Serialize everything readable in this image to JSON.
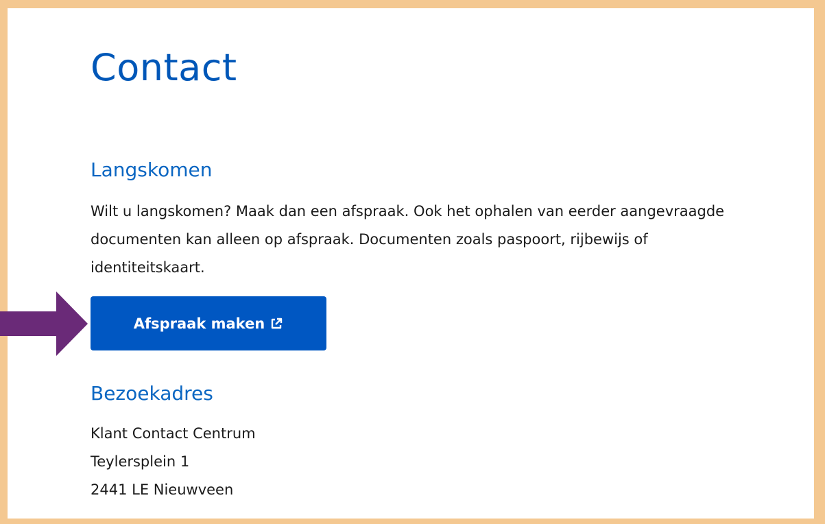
{
  "page": {
    "title": "Contact"
  },
  "langskomen": {
    "heading": "Langskomen",
    "text": "Wilt u langskomen? Maak dan een afspraak. Ook het ophalen van eerder aangevraagde documenten kan alleen op afspraak. Documenten zoals paspoort, rijbewijs of identiteitskaart.",
    "button_label": "Afspraak maken",
    "button_icon": "external-link-icon"
  },
  "bezoekadres": {
    "heading": "Bezoekadres",
    "lines": [
      "Klant Contact Centrum",
      "Teylersplein 1",
      "2441 LE Nieuwveen"
    ]
  },
  "annotation": {
    "arrow_icon": "pointer-arrow-icon",
    "arrow_color": "#6a2a78"
  },
  "colors": {
    "frame_border": "#f4c891",
    "heading_blue": "#0057b8",
    "button_blue": "#0057c2",
    "text": "#1a1a1a"
  }
}
